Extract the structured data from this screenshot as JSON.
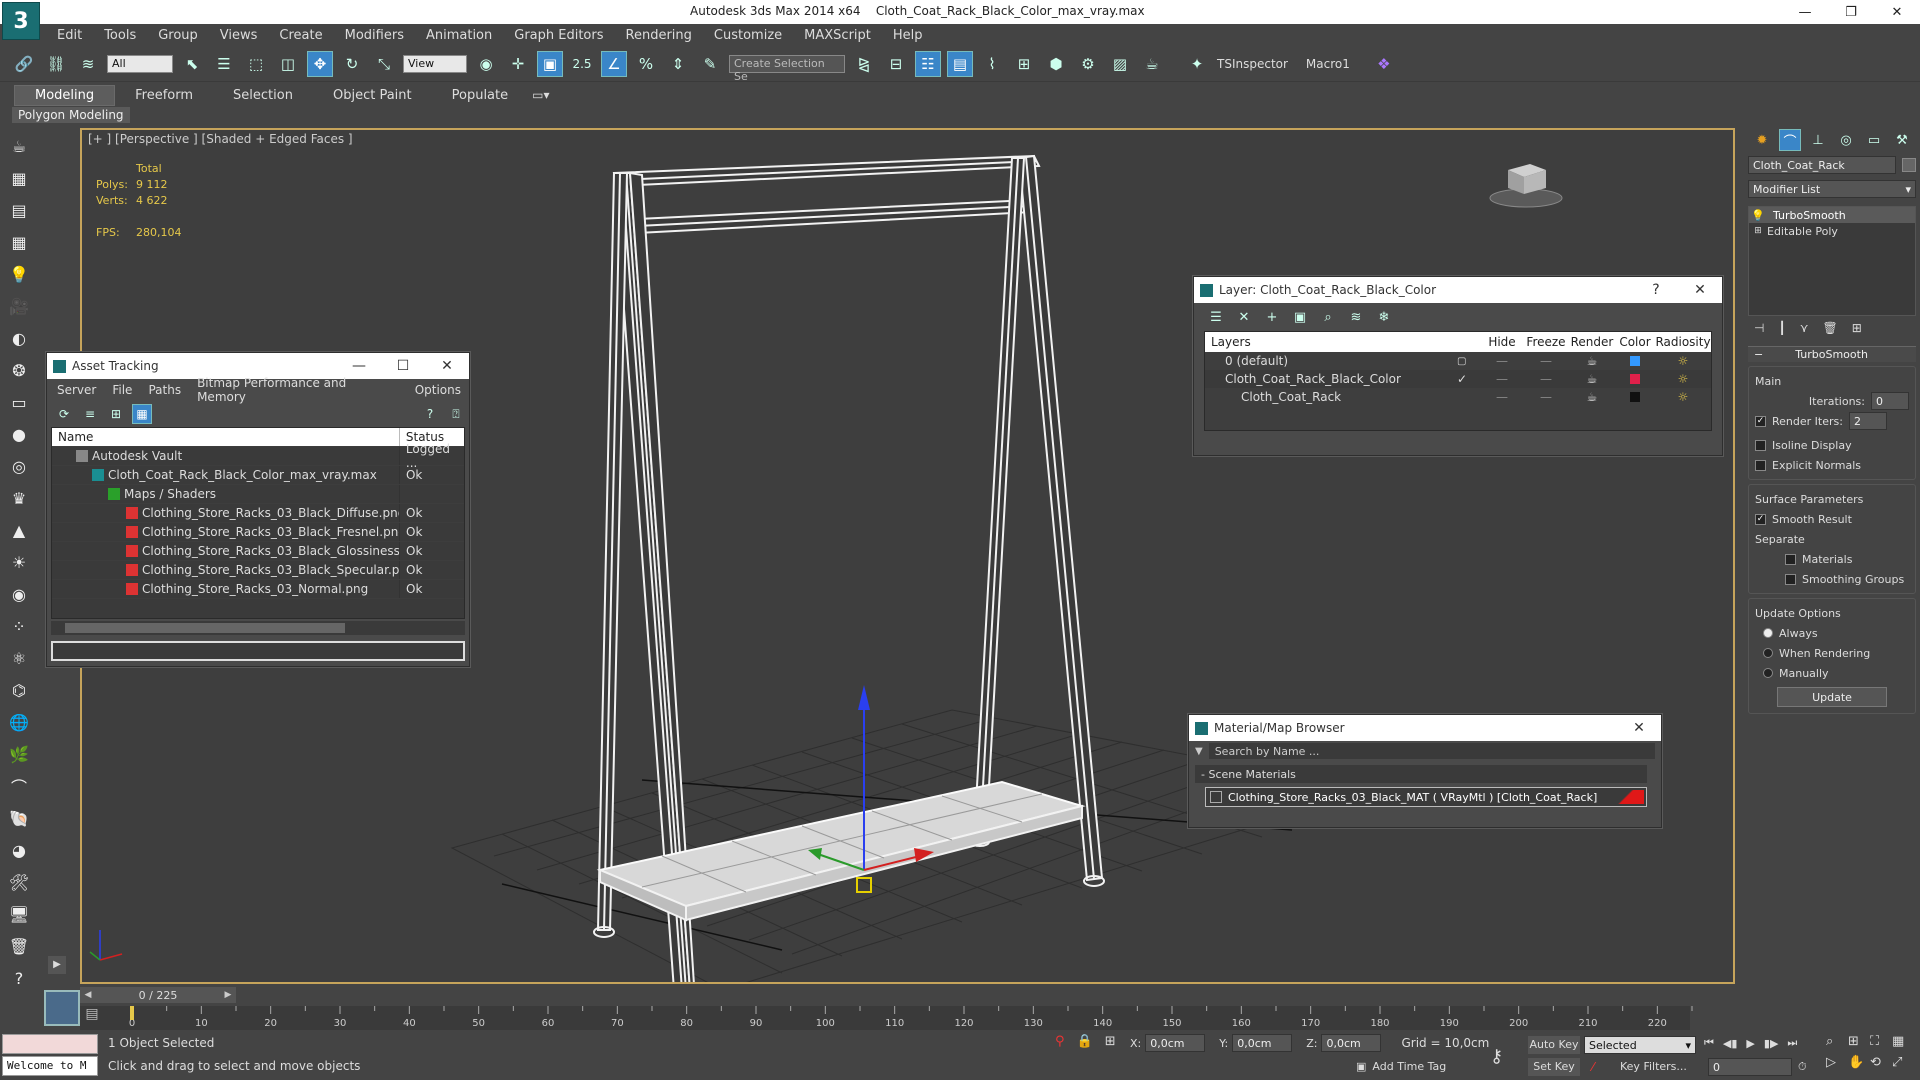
{
  "title": {
    "app": "Autodesk 3ds Max  2014 x64",
    "file": "Cloth_Coat_Rack_Black_Color_max_vray.max"
  },
  "menu": [
    "Edit",
    "Tools",
    "Group",
    "Views",
    "Create",
    "Modifiers",
    "Animation",
    "Graph Editors",
    "Rendering",
    "Customize",
    "MAXScript",
    "Help"
  ],
  "toolbar": {
    "filter": "All",
    "refcoord": "View",
    "snap_label": "2.5",
    "selset_placeholder": "Create Selection Se",
    "plugin1": "TSInspector",
    "plugin2": "Macro1"
  },
  "ribbon": {
    "tabs": [
      "Modeling",
      "Freeform",
      "Selection",
      "Object Paint",
      "Populate"
    ],
    "sub": "Polygon Modeling"
  },
  "viewport": {
    "label": "[+ ] [Perspective ] [Shaded + Edged Faces ]",
    "stats": {
      "total": "Total",
      "polys_label": "Polys:",
      "polys": "9 112",
      "verts_label": "Verts:",
      "verts": "4 622",
      "fps_label": "FPS:",
      "fps": "280,104"
    }
  },
  "asset_tracking": {
    "title": "Asset Tracking",
    "menu": [
      "Server",
      "File",
      "Paths",
      "Bitmap Performance and Memory",
      "Options"
    ],
    "col_name": "Name",
    "col_status": "Status",
    "rows": [
      {
        "name": "Autodesk Vault",
        "status": "Logged ..."
      },
      {
        "name": "Cloth_Coat_Rack_Black_Color_max_vray.max",
        "status": "Ok"
      },
      {
        "name": "Maps / Shaders",
        "status": ""
      },
      {
        "name": "Clothing_Store_Racks_03_Black_Diffuse.png",
        "status": "Ok"
      },
      {
        "name": "Clothing_Store_Racks_03_Black_Fresnel.png",
        "status": "Ok"
      },
      {
        "name": "Clothing_Store_Racks_03_Black_Glossiness.png",
        "status": "Ok"
      },
      {
        "name": "Clothing_Store_Racks_03_Black_Specular.png",
        "status": "Ok"
      },
      {
        "name": "Clothing_Store_Racks_03_Normal.png",
        "status": "Ok"
      }
    ]
  },
  "layer_window": {
    "title": "Layer: Cloth_Coat_Rack_Black_Color",
    "help": "?",
    "cols": [
      "Layers",
      "Hide",
      "Freeze",
      "Render",
      "Color",
      "Radiosity"
    ],
    "rows": [
      {
        "name": "0 (default)",
        "color": "#3399ff"
      },
      {
        "name": "Cloth_Coat_Rack_Black_Color",
        "color": "#e0204a"
      },
      {
        "name": "Cloth_Coat_Rack",
        "color": "#111111"
      }
    ]
  },
  "material_browser": {
    "title": "Material/Map Browser",
    "search_placeholder": "Search by Name ...",
    "section": "- Scene Materials",
    "item": "Clothing_Store_Racks_03_Black_MAT  ( VRayMtl )  [Cloth_Coat_Rack]"
  },
  "command_panel": {
    "object_name": "Cloth_Coat_Rack",
    "modifier_list": "Modifier List",
    "stack": [
      "TurboSmooth",
      "Editable Poly"
    ],
    "rollout": "TurboSmooth",
    "main": "Main",
    "iterations_label": "Iterations:",
    "iterations": "0",
    "render_iters_label": "Render Iters:",
    "render_iters": "2",
    "isoline": "Isoline Display",
    "explicit": "Explicit Normals",
    "surface_params": "Surface Parameters",
    "smooth_result": "Smooth Result",
    "separate": "Separate",
    "materials": "Materials",
    "smoothing_groups": "Smoothing Groups",
    "update_options": "Update Options",
    "always": "Always",
    "when_rendering": "When Rendering",
    "manually": "Manually",
    "update_btn": "Update"
  },
  "timeline": {
    "frame": "0 / 225",
    "ticks": [
      "0",
      "10",
      "20",
      "30",
      "40",
      "50",
      "60",
      "70",
      "80",
      "90",
      "100",
      "110",
      "120",
      "130",
      "140",
      "150",
      "160",
      "170",
      "180",
      "190",
      "200",
      "210",
      "220"
    ]
  },
  "status": {
    "selected": "1 Object Selected",
    "hint": "Click and drag to select and move objects",
    "welcome": "Welcome to M",
    "x_label": "X:",
    "x": "0,0cm",
    "y_label": "Y:",
    "y": "0,0cm",
    "z_label": "Z:",
    "z": "0,0cm",
    "grid": "Grid = 10,0cm",
    "add_time_tag": "Add Time Tag",
    "auto_key": "Auto Key",
    "set_key": "Set Key",
    "selected_dd": "Selected",
    "key_filters": "Key Filters...",
    "frame_field": "0"
  }
}
